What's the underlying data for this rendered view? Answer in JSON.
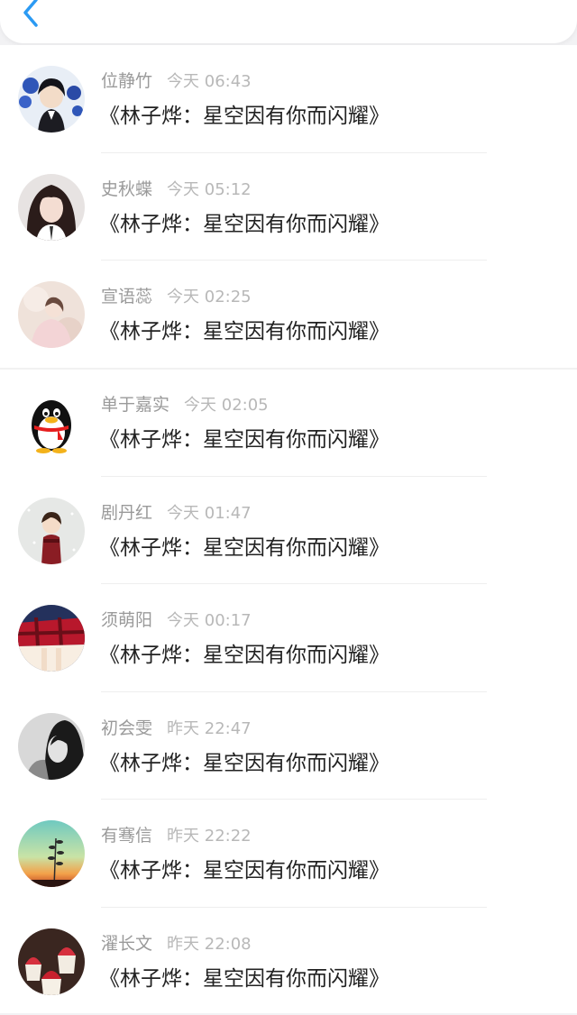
{
  "header": {
    "back_icon": "chevron-left-icon",
    "accent_color": "#2b9af3"
  },
  "messages": [
    {
      "name": "位静竹",
      "time": "今天 06:43",
      "text": "《林子烨：星空因有你而闪耀》",
      "avatar": "anime-boy-avatar"
    },
    {
      "name": "史秋蝶",
      "time": "今天 05:12",
      "text": "《林子烨：星空因有你而闪耀》",
      "avatar": "girl-photo-avatar"
    },
    {
      "name": "宣语蕊",
      "time": "今天 02:25",
      "text": "《林子烨：星空因有你而闪耀》",
      "avatar": "pastel-girl-avatar"
    },
    {
      "name": "单于嘉实",
      "time": "今天 02:05",
      "text": "《林子烨：星空因有你而闪耀》",
      "avatar": "penguin-avatar"
    },
    {
      "name": "剧丹红",
      "time": "今天 01:47",
      "text": "《林子烨：星空因有你而闪耀》",
      "avatar": "cartoon-snow-avatar"
    },
    {
      "name": "须萌阳",
      "time": "今天 00:17",
      "text": "《林子烨：星空因有你而闪耀》",
      "avatar": "red-plaid-avatar"
    },
    {
      "name": "初会雯",
      "time": "昨天 22:47",
      "text": "《林子烨：星空因有你而闪耀》",
      "avatar": "bw-portrait-avatar"
    },
    {
      "name": "有骞信",
      "time": "昨天 22:22",
      "text": "《林子烨：星空因有你而闪耀》",
      "avatar": "sunset-plant-avatar"
    },
    {
      "name": "濯长文",
      "time": "昨天 22:08",
      "text": "《林子烨：星空因有你而闪耀》",
      "avatar": "cupcakes-avatar"
    }
  ]
}
